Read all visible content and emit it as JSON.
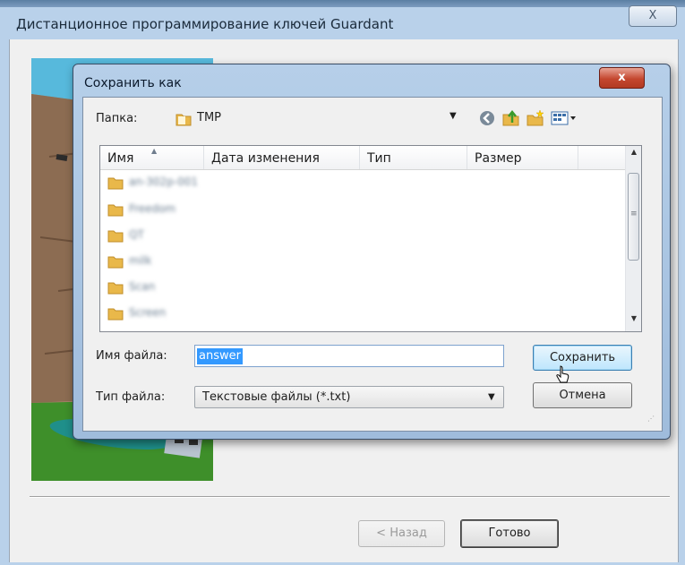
{
  "outer_window": {
    "title": "Дистанционное программирование ключей Guardant",
    "close_glyph": "X",
    "back_label": "< Назад",
    "done_label": "Готово"
  },
  "save_dialog": {
    "title": "Сохранить как",
    "close_glyph": "x",
    "folder_label": "Папка:",
    "folder_value": "TMP",
    "toolbar_icons": [
      "back-icon",
      "up-folder-icon",
      "new-folder-icon",
      "view-menu-icon"
    ],
    "columns": [
      "Имя",
      "Дата изменения",
      "Тип",
      "Размер"
    ],
    "items": [
      {
        "name": "an-302p-001"
      },
      {
        "name": "Freedom"
      },
      {
        "name": "QT"
      },
      {
        "name": "milk"
      },
      {
        "name": "Scan"
      },
      {
        "name": "Screen"
      }
    ],
    "filename_label": "Имя файла:",
    "filename_value": "answer",
    "filetype_label": "Тип файла:",
    "filetype_value": "Текстовые файлы (*.txt)",
    "save_label": "Сохранить",
    "cancel_label": "Отмена"
  },
  "colors": {
    "title_bar": "#b9d1ea",
    "close_red": "#c4472f",
    "selection": "#3399ff",
    "folder": "#e9b84a"
  }
}
